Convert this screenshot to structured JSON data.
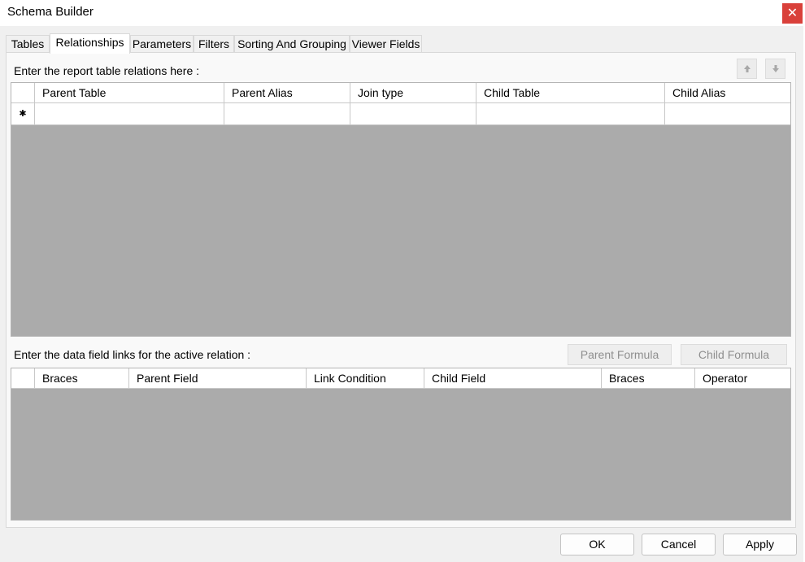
{
  "window": {
    "title": "Schema Builder",
    "close_glyph": "✕"
  },
  "tabs": [
    {
      "label": "Tables"
    },
    {
      "label": "Relationships",
      "active": true
    },
    {
      "label": "Parameters"
    },
    {
      "label": "Filters"
    },
    {
      "label": "Sorting And Grouping"
    },
    {
      "label": "Viewer Fields"
    }
  ],
  "relations": {
    "prompt": "Enter the report table relations here :",
    "move_up_icon": "arrow-up-icon",
    "move_down_icon": "arrow-down-icon",
    "columns": [
      "Parent Table",
      "Parent Alias",
      "Join type",
      "Child Table",
      "Child Alias"
    ],
    "new_row_marker": "✱",
    "rows": []
  },
  "links": {
    "prompt": "Enter the data field links for the active relation :",
    "parent_formula_label": "Parent Formula",
    "child_formula_label": "Child Formula",
    "columns": [
      "Braces",
      "Parent Field",
      "Link Condition",
      "Child Field",
      "Braces",
      "Operator"
    ],
    "rows": []
  },
  "footer": {
    "ok_label": "OK",
    "cancel_label": "Cancel",
    "apply_label": "Apply"
  },
  "colors": {
    "close": "#d9403a",
    "grid_bg": "#ababab"
  }
}
